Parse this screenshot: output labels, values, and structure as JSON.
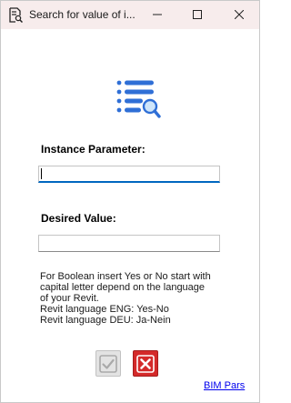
{
  "window": {
    "title": "Search for value of i...",
    "icons": {
      "app": "document-search-icon",
      "minimize": "minimize-icon",
      "maximize": "maximize-icon",
      "close": "close-icon"
    }
  },
  "logo": {
    "icon": "list-search-icon",
    "color": "#2f6fd6"
  },
  "form": {
    "instance_label": "Instance Parameter:",
    "instance_value": "",
    "desired_label": "Desired Value:",
    "desired_value": ""
  },
  "help_lines": [
    "For Boolean insert Yes or No start with",
    "capital letter depend on the language",
    "of your Revit.",
    "Revit language ENG: Yes-No",
    "Revit language DEU: Ja-Nein"
  ],
  "buttons": {
    "ok_icon": "checkmark-icon",
    "cancel_icon": "x-icon",
    "cancel_color": "#d42a2a"
  },
  "link_text": "BIM Pars"
}
